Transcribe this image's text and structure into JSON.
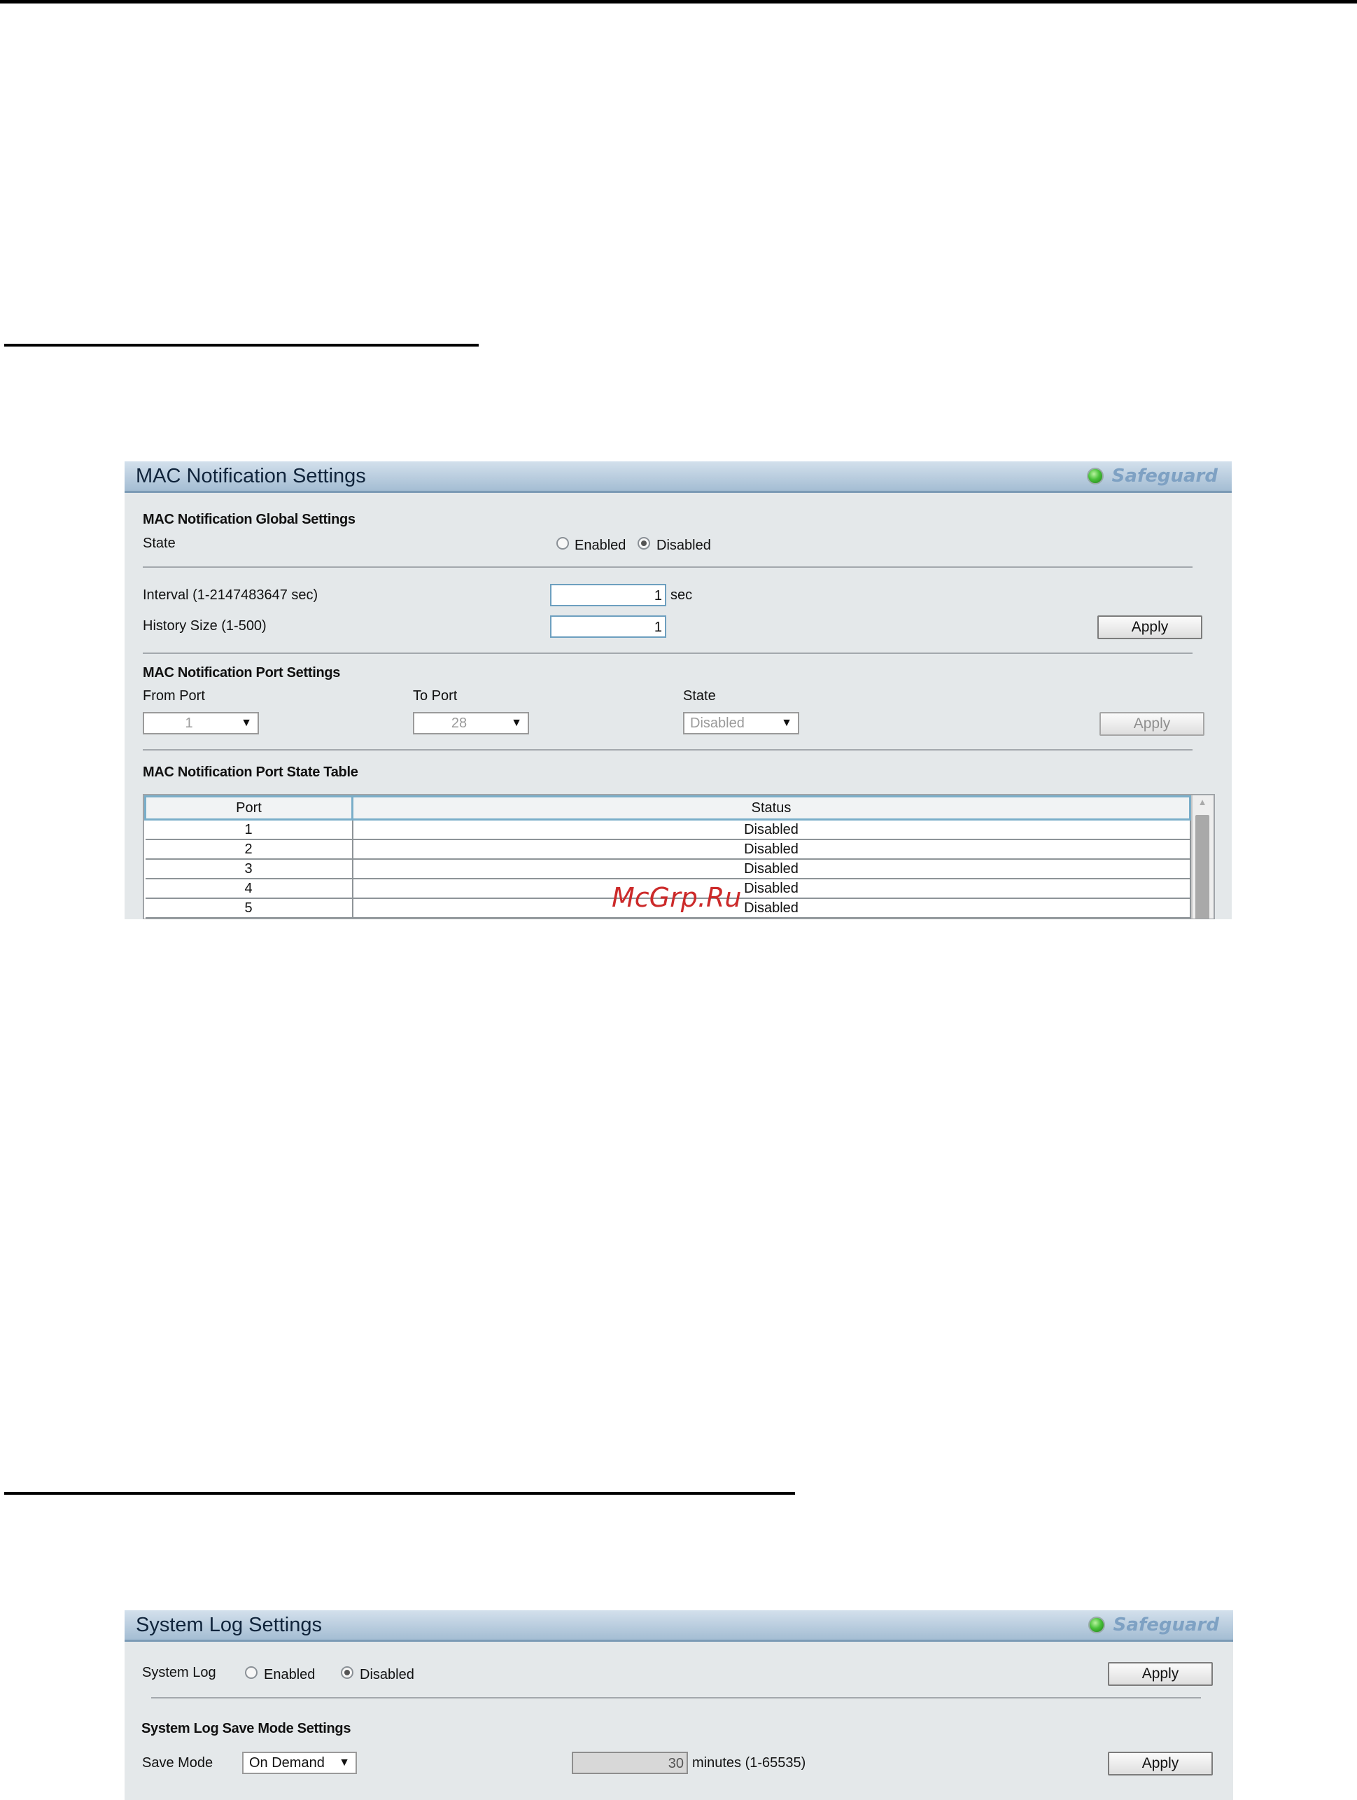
{
  "mac_panel": {
    "title": "MAC Notification Settings",
    "safeguard_label": "Safeguard",
    "global_section": "MAC Notification Global Settings",
    "state_label": "State",
    "state_enabled": "Enabled",
    "state_disabled": "Disabled",
    "state_selected": "Disabled",
    "interval_label": "Interval (1-2147483647 sec)",
    "interval_value": "1",
    "interval_unit": "sec",
    "history_label": "History Size (1-500)",
    "history_value": "1",
    "apply_label": "Apply",
    "port_section": "MAC Notification Port Settings",
    "from_port_label": "From Port",
    "from_port_value": "1",
    "to_port_label": "To Port",
    "to_port_value": "28",
    "port_state_label": "State",
    "port_state_value": "Disabled",
    "port_apply_label": "Apply",
    "table_section": "MAC Notification Port State Table",
    "table_headers": [
      "Port",
      "Status"
    ],
    "table_rows": [
      [
        "1",
        "Disabled"
      ],
      [
        "2",
        "Disabled"
      ],
      [
        "3",
        "Disabled"
      ],
      [
        "4",
        "Disabled"
      ],
      [
        "5",
        "Disabled"
      ]
    ]
  },
  "syslog_panel": {
    "title": "System Log Settings",
    "safeguard_label": "Safeguard",
    "system_log_label": "System Log",
    "enabled_label": "Enabled",
    "disabled_label": "Disabled",
    "selected": "Disabled",
    "apply_label": "Apply",
    "save_mode_section": "System Log Save Mode Settings",
    "save_mode_label": "Save Mode",
    "save_mode_value": "On Demand",
    "minutes_value": "30",
    "minutes_unit": "minutes (1-65535)",
    "save_apply_label": "Apply"
  },
  "watermark": "McGrp.Ru",
  "colors": {
    "header_gradient_top": "#d3e0ec",
    "header_gradient_bottom": "#a4bdd3",
    "panel_bg": "#e4e8ea",
    "safeguard_text": "#7ea1c3",
    "safeguard_led": "#49c23a",
    "watermark": "#cc2a2a"
  },
  "icons": [
    "safeguard-led-icon",
    "dropdown-arrow-icon",
    "scroll-up-icon"
  ]
}
